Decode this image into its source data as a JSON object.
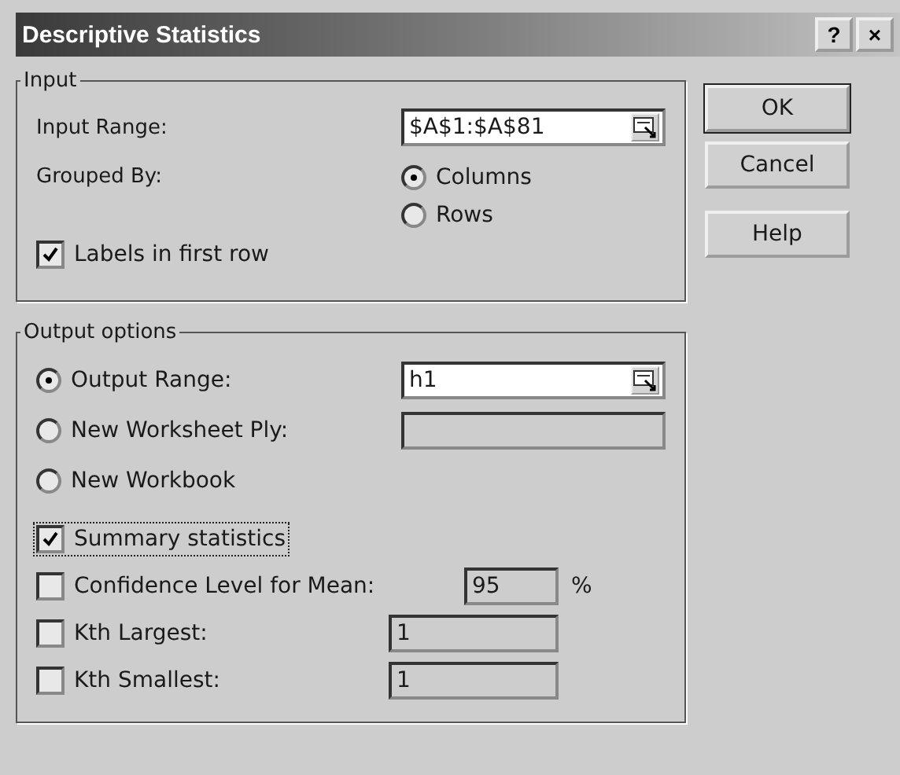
{
  "window": {
    "title": "Descriptive Statistics",
    "title_buttons": [
      "?",
      "×"
    ]
  },
  "input": {
    "group_label": "Input",
    "range": {
      "label": "Input Range:",
      "value": "$A$1:$A$81"
    },
    "grouped_by": {
      "label": "Grouped By:",
      "options": [
        {
          "label": "Columns",
          "selected": true
        },
        {
          "label": "Rows",
          "selected": false
        }
      ]
    },
    "labels_in_first_row": {
      "label": "Labels in first row",
      "checked": true
    }
  },
  "output": {
    "group_label": "Output options",
    "destinations": [
      {
        "label": "Output Range:",
        "selected": true,
        "field": {
          "value": "h1",
          "picker": true,
          "disabled": false
        }
      },
      {
        "label": "New Worksheet Ply:",
        "selected": false,
        "field": {
          "picker": false,
          "disabled": true
        }
      },
      {
        "label": "New Workbook",
        "selected": false
      }
    ],
    "options": [
      {
        "label": "Summary statistics",
        "checked": true,
        "focused": true
      },
      {
        "label": "Confidence Level for Mean:",
        "checked": false,
        "focused": false,
        "field": {
          "value": "95",
          "disabled": true,
          "wide": false
        },
        "suffix": "%"
      },
      {
        "label": "Kth Largest:",
        "checked": false,
        "focused": false,
        "field": {
          "value": "1",
          "disabled": true,
          "wide": true
        }
      },
      {
        "label": "Kth Smallest:",
        "checked": false,
        "focused": false,
        "field": {
          "value": "1",
          "disabled": true,
          "wide": true
        }
      }
    ]
  },
  "buttons": [
    "OK",
    "Cancel",
    "Help"
  ]
}
